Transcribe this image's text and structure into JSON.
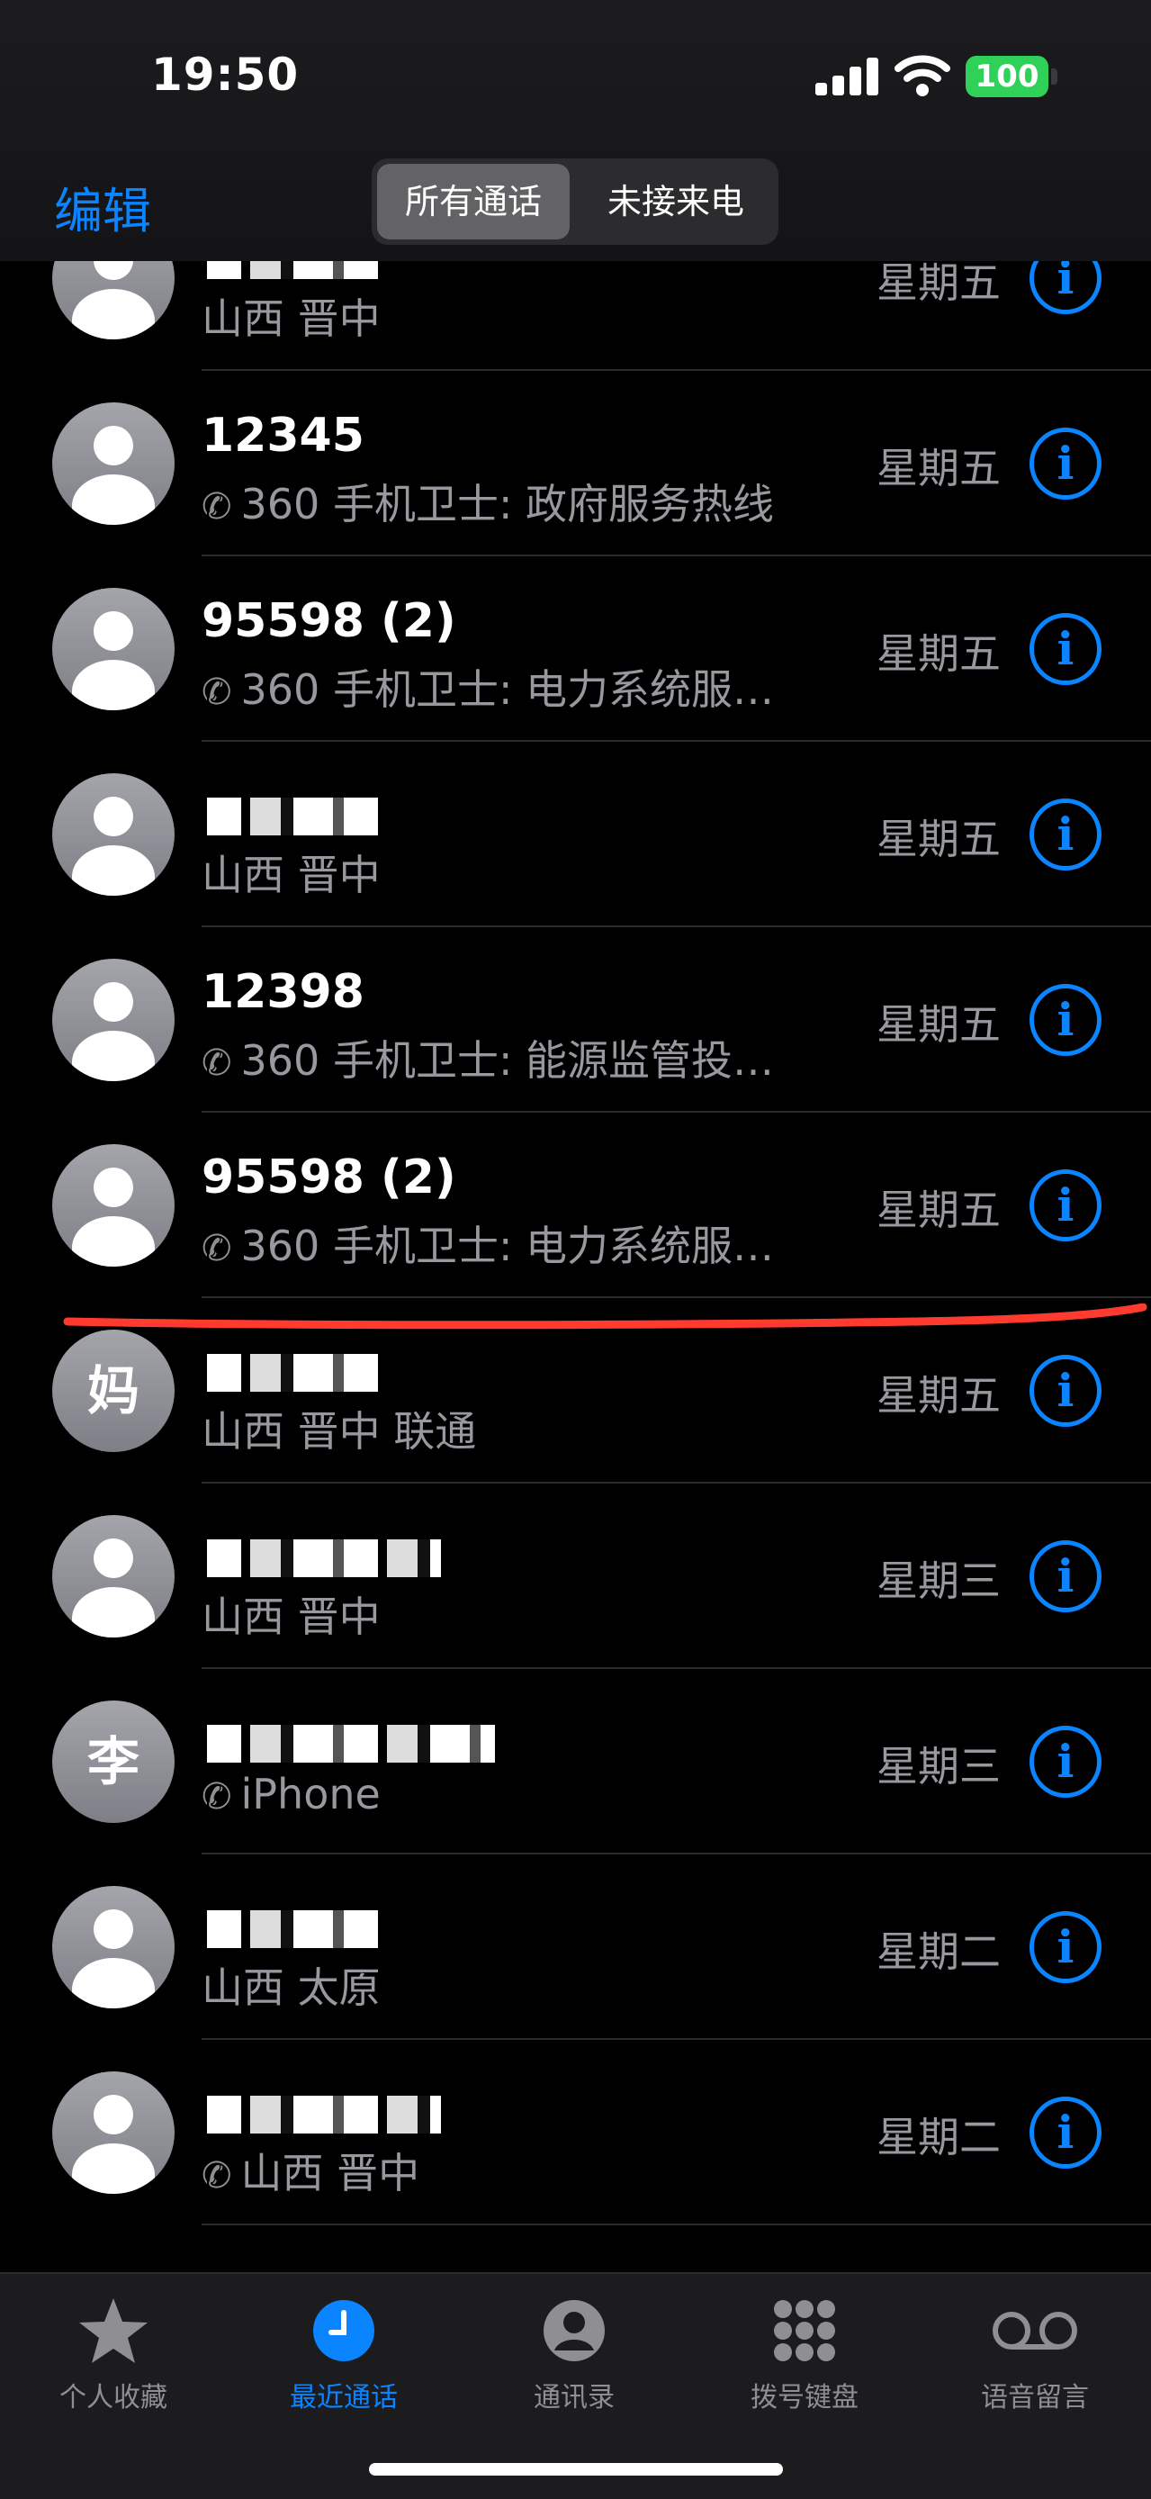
{
  "status": {
    "time": "19:50",
    "battery": "100"
  },
  "header": {
    "edit_label": "编辑",
    "segments": [
      {
        "label": "所有通话"
      },
      {
        "label": "未接来电"
      }
    ]
  },
  "calls": [
    {
      "name": "",
      "sub": "山西 晋中",
      "day": "星期五",
      "avatar": "",
      "phone_icon": false,
      "redacted": true
    },
    {
      "name": "12345",
      "sub": "360 手机卫士: 政府服务热线",
      "day": "星期五",
      "avatar": "",
      "phone_icon": true,
      "redacted": false
    },
    {
      "name": "95598 (2)",
      "sub": "360 手机卫士: 电力系统服…",
      "day": "星期五",
      "avatar": "",
      "phone_icon": true,
      "redacted": false
    },
    {
      "name": "",
      "sub": "山西 晋中",
      "day": "星期五",
      "avatar": "",
      "phone_icon": false,
      "redacted": true
    },
    {
      "name": "12398",
      "sub": "360 手机卫士: 能源监管投…",
      "day": "星期五",
      "avatar": "",
      "phone_icon": true,
      "redacted": false
    },
    {
      "name": "95598 (2)",
      "sub": "360 手机卫士: 电力系统服…",
      "day": "星期五",
      "avatar": "",
      "phone_icon": true,
      "redacted": false
    },
    {
      "name": "",
      "sub": "山西 晋中 联通",
      "day": "星期五",
      "avatar": "妈",
      "phone_icon": false,
      "redacted": true
    },
    {
      "name": "",
      "sub": "山西 晋中",
      "day": "星期三",
      "avatar": "",
      "phone_icon": false,
      "redacted": true
    },
    {
      "name": "",
      "sub": "iPhone",
      "day": "星期三",
      "avatar": "李",
      "phone_icon": true,
      "redacted": true
    },
    {
      "name": "",
      "sub": "山西 太原",
      "day": "星期二",
      "avatar": "",
      "phone_icon": false,
      "redacted": true
    },
    {
      "name": "",
      "sub": "山西 晋中",
      "day": "星期二",
      "avatar": "",
      "phone_icon": true,
      "redacted": true
    }
  ],
  "tabs": [
    {
      "label": "个人收藏",
      "icon": "star-icon",
      "active": false
    },
    {
      "label": "最近通话",
      "icon": "clock-icon",
      "active": true
    },
    {
      "label": "通讯录",
      "icon": "person-circle-icon",
      "active": false
    },
    {
      "label": "拨号键盘",
      "icon": "keypad-icon",
      "active": false
    },
    {
      "label": "语音留言",
      "icon": "voicemail-icon",
      "active": false
    }
  ],
  "colors": {
    "accent": "#0a84ff",
    "battery": "#30d158",
    "annotation": "#ff3b30"
  }
}
